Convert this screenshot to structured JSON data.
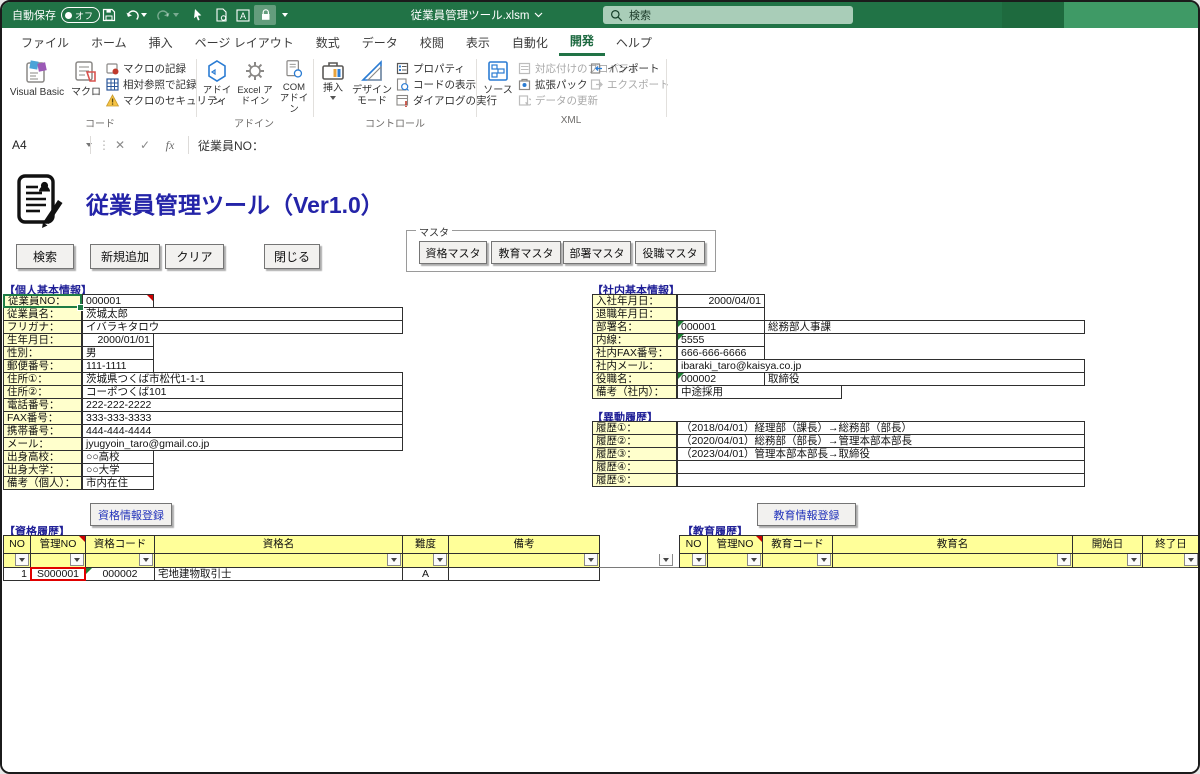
{
  "titlebar": {
    "autosave_label": "自動保存",
    "autosave_state": "オフ",
    "filename": "従業員管理ツール.xlsm",
    "search_placeholder": "検索"
  },
  "ribbon": {
    "tabs": [
      "ファイル",
      "ホーム",
      "挿入",
      "ページ レイアウト",
      "数式",
      "データ",
      "校閲",
      "表示",
      "自動化",
      "開発",
      "ヘルプ"
    ],
    "active_tab": "開発",
    "code_group": {
      "label": "コード",
      "visual_basic": "Visual Basic",
      "macro": "マクロ",
      "record_macro": "マクロの記録",
      "relative_ref": "相対参照で記録",
      "macro_security": "マクロのセキュリティ"
    },
    "addin_group": {
      "label": "アドイン",
      "addin": "アドイン",
      "excel_addin": "Excel アドイン",
      "com_addin": "COM アドイン"
    },
    "control_group": {
      "label": "コントロール",
      "insert": "挿入",
      "design_mode": "デザイン モード",
      "properties": "プロパティ",
      "view_code": "コードの表示",
      "run_dialog": "ダイアログの実行"
    },
    "xml_group": {
      "label": "XML",
      "source": "ソース",
      "map_properties": "対応付けのプロパティ",
      "expansion_packs": "拡張パック",
      "refresh_data": "データの更新",
      "import": "インポート",
      "export": "エクスポート"
    }
  },
  "formula_bar": {
    "name_box": "A4",
    "formula": "従業員NO："
  },
  "sheet": {
    "app_title": "従業員管理ツール（Ver1.0）",
    "buttons": {
      "search": "検索",
      "add": "新規追加",
      "clear": "クリア",
      "close": "閉じる"
    },
    "master": {
      "label": "マスタ",
      "qualification": "資格マスタ",
      "education": "教育マスタ",
      "department": "部署マスタ",
      "position": "役職マスタ"
    },
    "personal": {
      "title": "【個人基本情報】",
      "rows": [
        {
          "label": "従業員NO：",
          "value": "000001"
        },
        {
          "label": "従業員名：",
          "value": "茨城太郎"
        },
        {
          "label": "フリガナ：",
          "value": "イバラキタロウ"
        },
        {
          "label": "生年月日：",
          "value": "2000/01/01"
        },
        {
          "label": "性別：",
          "value": "男"
        },
        {
          "label": "郵便番号：",
          "value": "111-1111"
        },
        {
          "label": "住所①：",
          "value": "茨城県つくば市松代1-1-1"
        },
        {
          "label": "住所②：",
          "value": "コーポつくば101"
        },
        {
          "label": "電話番号：",
          "value": "222-222-2222"
        },
        {
          "label": "FAX番号：",
          "value": "333-333-3333"
        },
        {
          "label": "携帯番号：",
          "value": "444-444-4444"
        },
        {
          "label": "メール：",
          "value": "jyugyoin_taro@gmail.co.jp"
        },
        {
          "label": "出身高校：",
          "value": "○○高校"
        },
        {
          "label": "出身大学：",
          "value": "○○大学"
        },
        {
          "label": "備考（個人）：",
          "value": "市内在住"
        }
      ]
    },
    "company": {
      "title": "【社内基本情報】",
      "rows": [
        {
          "label": "入社年月日：",
          "value": "2000/04/01"
        },
        {
          "label": "退職年月日：",
          "value": ""
        },
        {
          "label": "部署名：",
          "code": "000001",
          "value": "総務部人事課"
        },
        {
          "label": "内線：",
          "value": "5555"
        },
        {
          "label": "社内FAX番号：",
          "value": "666-666-6666"
        },
        {
          "label": "社内メール：",
          "value": "ibaraki_taro@kaisya.co.jp"
        },
        {
          "label": "役職名：",
          "code": "000002",
          "value": "取締役"
        },
        {
          "label": "備考（社内）：",
          "value": "中途採用"
        }
      ]
    },
    "transfer": {
      "title": "【異動履歴】",
      "rows": [
        {
          "label": "履歴①：",
          "value": "（2018/04/01）経理部（課長）→総務部（部長）"
        },
        {
          "label": "履歴②：",
          "value": "（2020/04/01）総務部（部長）→管理本部本部長"
        },
        {
          "label": "履歴③：",
          "value": "（2023/04/01）管理本部本部長→取締役"
        },
        {
          "label": "履歴④：",
          "value": ""
        },
        {
          "label": "履歴⑤：",
          "value": ""
        }
      ]
    },
    "qualification_history": {
      "title": "【資格履歴】",
      "register": "資格情報登録",
      "headers": [
        "NO",
        "管理NO",
        "資格コード",
        "資格名",
        "難度",
        "備考"
      ],
      "row": {
        "no": "1",
        "kanri_no": "S000001",
        "code": "000002",
        "name": "宅地建物取引士",
        "rank": "A",
        "note": ""
      }
    },
    "education_history": {
      "title": "【教育履歴】",
      "register": "教育情報登録",
      "headers": [
        "NO",
        "管理NO",
        "教育コード",
        "教育名",
        "開始日",
        "終了日"
      ]
    }
  },
  "colors": {
    "titlebar": "#217346",
    "label_fill": "#ffffcc",
    "header_fill": "#ffff99",
    "section_title": "#1e1e96",
    "app_title": "#2424a8",
    "highlight_red": "#e00000"
  }
}
